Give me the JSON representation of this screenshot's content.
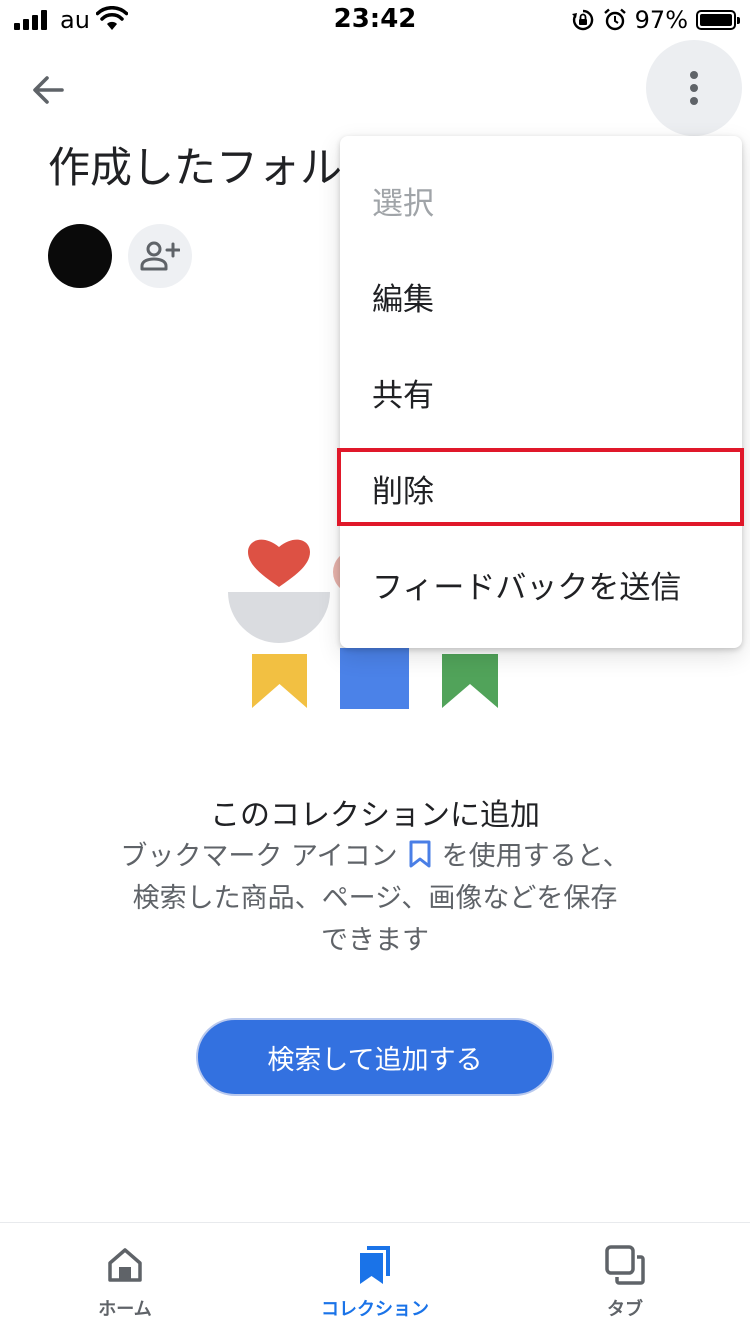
{
  "status_bar": {
    "carrier": "au",
    "time": "23:42",
    "battery": "97%",
    "icons": [
      "signal-icon",
      "wifi-icon",
      "rotation-lock-icon",
      "alarm-icon",
      "battery-icon"
    ]
  },
  "header": {
    "title": "作成したフォル",
    "back_icon": "arrow-back-icon",
    "more_icon": "more-vert-icon"
  },
  "collaborators": {
    "add_icon": "person-add-icon"
  },
  "menu": {
    "items": [
      {
        "label": "選択",
        "enabled": false
      },
      {
        "label": "編集",
        "enabled": true
      },
      {
        "label": "共有",
        "enabled": true
      },
      {
        "label": "削除",
        "enabled": true,
        "highlighted": true
      },
      {
        "label": "フィードバックを送信",
        "enabled": true
      }
    ]
  },
  "empty_state": {
    "title": "このコレクションに追加",
    "desc_part1": "ブックマーク アイコン",
    "desc_part2": "を使用すると、検索した商品、ページ、画像などを保存できます",
    "button": "検索して追加する"
  },
  "bottom_nav": {
    "items": [
      {
        "label": "ホーム",
        "icon": "home-icon",
        "active": false
      },
      {
        "label": "コレクション",
        "icon": "collections-icon",
        "active": true
      },
      {
        "label": "タブ",
        "icon": "tabs-icon",
        "active": false
      }
    ]
  },
  "colors": {
    "accent": "#1a73e8",
    "button": "#3371e0",
    "highlight": "#e0182a",
    "heart": "#dd5144",
    "yellow": "#f2c042",
    "blue": "#4b82e8",
    "green": "#51a35a"
  }
}
